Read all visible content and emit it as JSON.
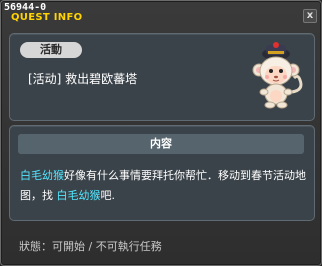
{
  "window": {
    "id": "56944-0",
    "title": "QUEST INFO",
    "close_label": "x"
  },
  "quest": {
    "badge": "活動",
    "name": "[活动] 救出碧欧蕃塔"
  },
  "content": {
    "header": "内容",
    "parts": [
      {
        "text": "白毛幼猴",
        "highlight": true
      },
      {
        "text": "好像有什么事情要拜托你帮忙．移动到春节活动地图，找 ",
        "highlight": false
      },
      {
        "text": "白毛幼猴",
        "highlight": true
      },
      {
        "text": "吧.",
        "highlight": false
      }
    ]
  },
  "status": "狀態：可開始 / 不可執行任務",
  "colors": {
    "title": "#ffd400",
    "highlight": "#52e6ff"
  }
}
